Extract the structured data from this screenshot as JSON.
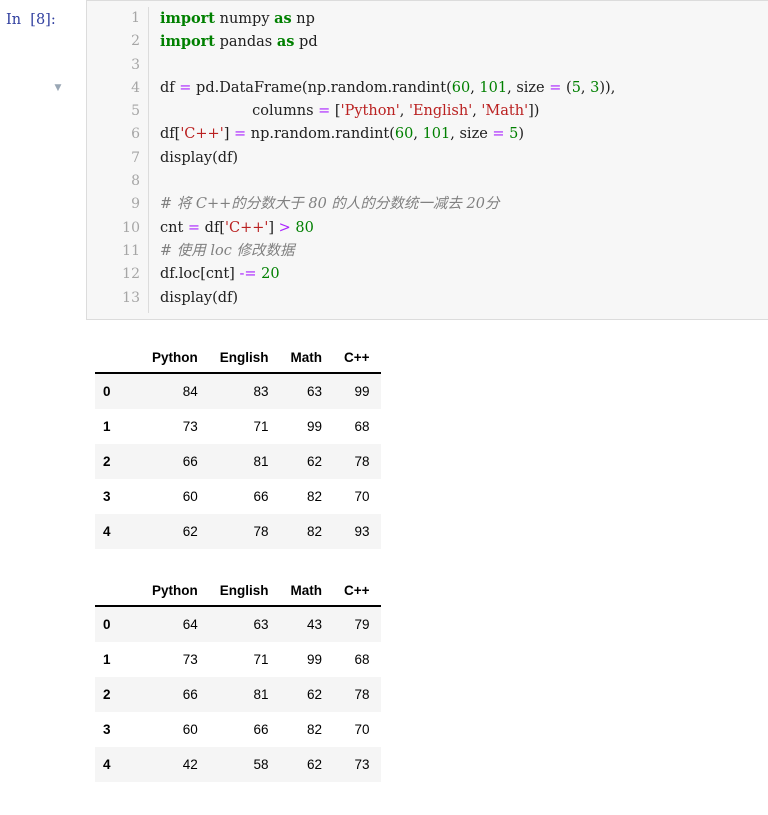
{
  "cell": {
    "prompt_label": "In  [8]:",
    "fold_marker_icon": "triangle-down-icon",
    "fold_marker_line": 4,
    "line_numbers": [
      1,
      2,
      3,
      4,
      5,
      6,
      7,
      8,
      9,
      10,
      11,
      12,
      13
    ],
    "code_lines": [
      [
        {
          "t": "import",
          "c": "kw"
        },
        {
          "t": " numpy ",
          "c": "plain"
        },
        {
          "t": "as",
          "c": "kw"
        },
        {
          "t": " np",
          "c": "plain"
        }
      ],
      [
        {
          "t": "import",
          "c": "kw"
        },
        {
          "t": " pandas ",
          "c": "plain"
        },
        {
          "t": "as",
          "c": "kw"
        },
        {
          "t": " pd",
          "c": "plain"
        }
      ],
      [],
      [
        {
          "t": "df ",
          "c": "plain"
        },
        {
          "t": "=",
          "c": "op"
        },
        {
          "t": " pd.DataFrame(np.random.randint(",
          "c": "plain"
        },
        {
          "t": "60",
          "c": "num"
        },
        {
          "t": ", ",
          "c": "plain"
        },
        {
          "t": "101",
          "c": "num"
        },
        {
          "t": ", size ",
          "c": "plain"
        },
        {
          "t": "=",
          "c": "op"
        },
        {
          "t": " (",
          "c": "plain"
        },
        {
          "t": "5",
          "c": "num"
        },
        {
          "t": ", ",
          "c": "plain"
        },
        {
          "t": "3",
          "c": "num"
        },
        {
          "t": ")),",
          "c": "plain"
        }
      ],
      [
        {
          "t": "                    columns ",
          "c": "plain"
        },
        {
          "t": "=",
          "c": "op"
        },
        {
          "t": " [",
          "c": "plain"
        },
        {
          "t": "'Python'",
          "c": "str"
        },
        {
          "t": ", ",
          "c": "plain"
        },
        {
          "t": "'English'",
          "c": "str"
        },
        {
          "t": ", ",
          "c": "plain"
        },
        {
          "t": "'Math'",
          "c": "str"
        },
        {
          "t": "])",
          "c": "plain"
        }
      ],
      [
        {
          "t": "df[",
          "c": "plain"
        },
        {
          "t": "'C++'",
          "c": "str"
        },
        {
          "t": "] ",
          "c": "plain"
        },
        {
          "t": "=",
          "c": "op"
        },
        {
          "t": " np.random.randint(",
          "c": "plain"
        },
        {
          "t": "60",
          "c": "num"
        },
        {
          "t": ", ",
          "c": "plain"
        },
        {
          "t": "101",
          "c": "num"
        },
        {
          "t": ", size ",
          "c": "plain"
        },
        {
          "t": "=",
          "c": "op"
        },
        {
          "t": " ",
          "c": "plain"
        },
        {
          "t": "5",
          "c": "num"
        },
        {
          "t": ")",
          "c": "plain"
        }
      ],
      [
        {
          "t": "display(df)",
          "c": "plain"
        }
      ],
      [],
      [
        {
          "t": "# 将 C++的分数大于 80 的人的分数统一减去 20分",
          "c": "cmt"
        }
      ],
      [
        {
          "t": "cnt ",
          "c": "plain"
        },
        {
          "t": "=",
          "c": "op"
        },
        {
          "t": " df[",
          "c": "plain"
        },
        {
          "t": "'C++'",
          "c": "str"
        },
        {
          "t": "] ",
          "c": "plain"
        },
        {
          "t": ">",
          "c": "op"
        },
        {
          "t": " ",
          "c": "plain"
        },
        {
          "t": "80",
          "c": "num"
        }
      ],
      [
        {
          "t": "# 使用 loc 修改数据",
          "c": "cmt"
        }
      ],
      [
        {
          "t": "df.loc[cnt] ",
          "c": "plain"
        },
        {
          "t": "-=",
          "c": "op"
        },
        {
          "t": " ",
          "c": "plain"
        },
        {
          "t": "20",
          "c": "num"
        }
      ],
      [
        {
          "t": "display(df)",
          "c": "plain"
        }
      ]
    ]
  },
  "outputs": [
    {
      "name": "dataframe-before",
      "index_header": "",
      "columns": [
        "Python",
        "English",
        "Math",
        "C++"
      ],
      "index": [
        "0",
        "1",
        "2",
        "3",
        "4"
      ],
      "rows": [
        [
          "84",
          "83",
          "63",
          "99"
        ],
        [
          "73",
          "71",
          "99",
          "68"
        ],
        [
          "66",
          "81",
          "62",
          "78"
        ],
        [
          "60",
          "66",
          "82",
          "70"
        ],
        [
          "62",
          "78",
          "82",
          "93"
        ]
      ]
    },
    {
      "name": "dataframe-after",
      "index_header": "",
      "columns": [
        "Python",
        "English",
        "Math",
        "C++"
      ],
      "index": [
        "0",
        "1",
        "2",
        "3",
        "4"
      ],
      "rows": [
        [
          "64",
          "63",
          "43",
          "79"
        ],
        [
          "73",
          "71",
          "99",
          "68"
        ],
        [
          "66",
          "81",
          "62",
          "78"
        ],
        [
          "60",
          "66",
          "82",
          "70"
        ],
        [
          "42",
          "58",
          "62",
          "73"
        ]
      ]
    }
  ],
  "theme": {
    "keyword_color": "#008000",
    "string_color": "#BA2121",
    "number_color": "#008000",
    "operator_color": "#AA22FF",
    "comment_color": "#808080",
    "prompt_color": "#303F9F",
    "cell_background": "#f7f7f7",
    "cell_border": "#dcdcdc",
    "gutter_text_color": "#a6a6a6",
    "table_stripe_color": "#f5f5f5"
  }
}
